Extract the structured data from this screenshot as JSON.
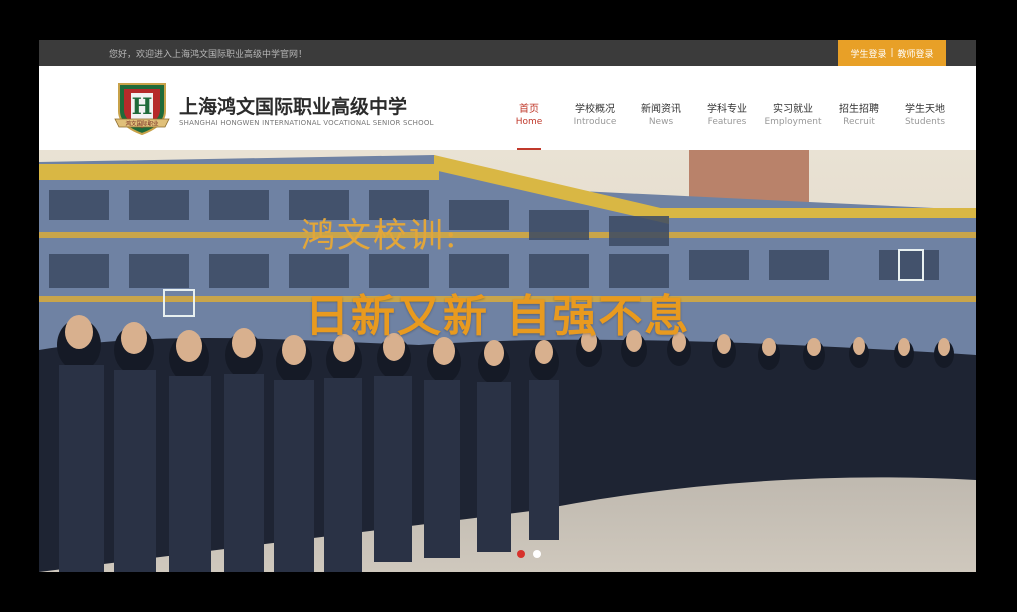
{
  "topbar": {
    "welcome": "您好，欢迎进入上海鸿文国际职业高级中学官网！",
    "student_login": "学生登录",
    "separator": "|",
    "teacher_login": "教师登录"
  },
  "brand": {
    "name_cn": "上海鸿文国际职业高级中学",
    "name_en": "SHANGHAI HONGWEN INTERNATIONAL VOCATIONAL SENIOR SCHOOL",
    "logo_letter": "H",
    "logo_ribbon": "鸿文国际职业"
  },
  "nav": [
    {
      "cn": "首页",
      "en": "Home"
    },
    {
      "cn": "学校概况",
      "en": "Introduce"
    },
    {
      "cn": "新闻资讯",
      "en": "News"
    },
    {
      "cn": "学科专业",
      "en": "Features"
    },
    {
      "cn": "实习就业",
      "en": "Employment"
    },
    {
      "cn": "招生招聘",
      "en": "Recruit"
    },
    {
      "cn": "学生天地",
      "en": "Students"
    }
  ],
  "banner": {
    "slogan_line1": "鸿文校训:",
    "slogan_line2": "日新又新  自强不息",
    "slides": 2,
    "active_slide": 1
  },
  "colors": {
    "accent_orange": "#e8a027",
    "active_red": "#c0392b",
    "slogan_gold": "#e89a1f",
    "topbar_bg": "#3b3b3b"
  }
}
